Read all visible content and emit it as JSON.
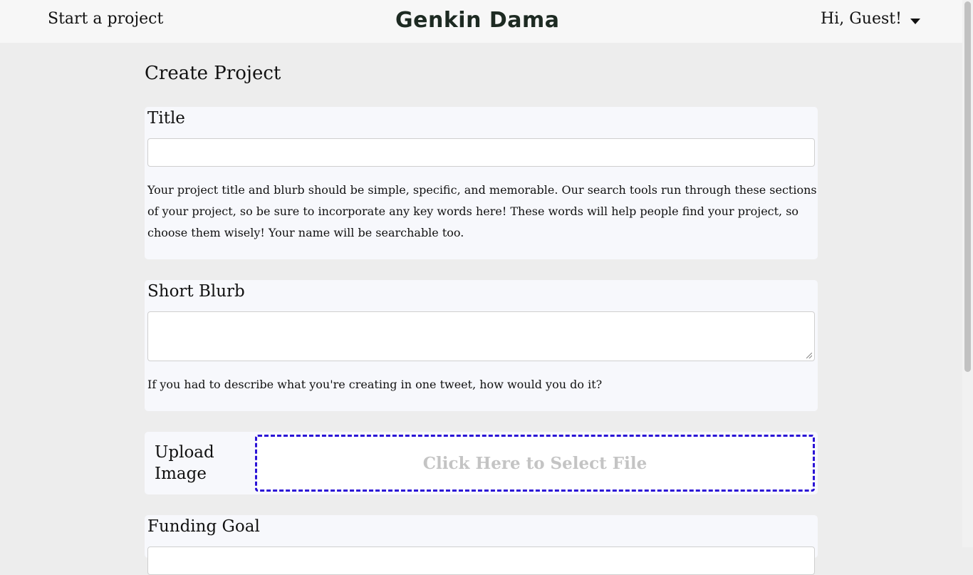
{
  "header": {
    "start_project": "Start a project",
    "brand": "Genkin Dama",
    "user_greeting": "Hi, Guest!"
  },
  "page": {
    "title": "Create Project"
  },
  "title_section": {
    "label": "Title",
    "value": "",
    "help": "Your project title and blurb should be simple, specific, and memorable. Our search tools run through these sections of your project, so be sure to incorporate any key words here! These words will help people find your project, so choose them wisely! Your name will be searchable too."
  },
  "blurb_section": {
    "label": "Short Blurb",
    "value": "",
    "help": "If you had to describe what you're creating in one tweet, how would you do it?"
  },
  "upload_section": {
    "label": "Upload Image",
    "dropzone_text": "Click Here to Select File"
  },
  "funding_section": {
    "label": "Funding Goal"
  },
  "colors": {
    "dropzone_border": "#2a12d6",
    "background": "#ededed",
    "card": "#f7f8fc"
  }
}
